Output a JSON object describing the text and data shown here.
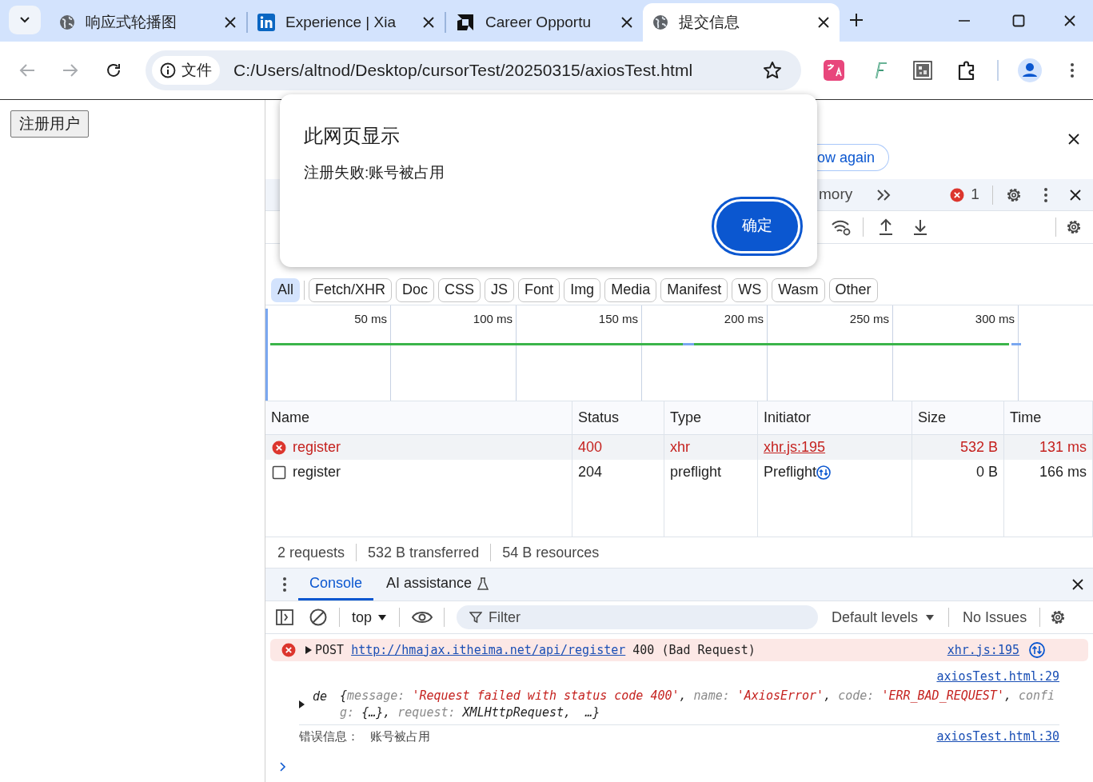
{
  "browser": {
    "tabs": [
      {
        "title": "响应式轮播图",
        "kind": "globe",
        "selected": false
      },
      {
        "title": "Experience | Xia",
        "kind": "linkedin",
        "selected": false
      },
      {
        "title": "Career Opportu",
        "kind": "amd",
        "selected": false
      },
      {
        "title": "提交信息",
        "kind": "globe",
        "selected": true
      }
    ],
    "address": {
      "security_label": "文件",
      "url": "C:/Users/altnod/Desktop/cursorTest/20250315/axiosTest.html"
    }
  },
  "page": {
    "button": "注册用户"
  },
  "dialog": {
    "title": "此网页显示",
    "message": "注册失败:账号被占用",
    "ok_button": "确定"
  },
  "devtools": {
    "notice_button": "ow again",
    "panel_tab": "mory",
    "error_count": "1",
    "filters": [
      {
        "label": "All",
        "selected": true
      },
      {
        "label": "Fetch/XHR",
        "selected": false
      },
      {
        "label": "Doc",
        "selected": false
      },
      {
        "label": "CSS",
        "selected": false
      },
      {
        "label": "JS",
        "selected": false
      },
      {
        "label": "Font",
        "selected": false
      },
      {
        "label": "Img",
        "selected": false
      },
      {
        "label": "Media",
        "selected": false
      },
      {
        "label": "Manifest",
        "selected": false
      },
      {
        "label": "WS",
        "selected": false
      },
      {
        "label": "Wasm",
        "selected": false
      },
      {
        "label": "Other",
        "selected": false
      }
    ],
    "timeline_labels": [
      "50 ms",
      "100 ms",
      "150 ms",
      "200 ms",
      "250 ms",
      "300 ms"
    ],
    "network": {
      "columns": [
        "Name",
        "Status",
        "Type",
        "Initiator",
        "Size",
        "Time"
      ],
      "rows": [
        {
          "kind": "error",
          "name": "register",
          "status": "400",
          "type": "xhr",
          "initiator": "xhr.js:195",
          "initiator_link": true,
          "size": "532 B",
          "time": "131 ms"
        },
        {
          "kind": "preflight",
          "name": "register",
          "status": "204",
          "type": "preflight",
          "initiator": "Preflight",
          "initiator_link": false,
          "size": "0 B",
          "time": "166 ms"
        }
      ]
    },
    "summary": [
      "2 requests",
      "532 B transferred",
      "54 B resources"
    ],
    "drawer_tabs": [
      {
        "label": "Console",
        "selected": true
      },
      {
        "label": "AI assistance",
        "selected": false
      }
    ],
    "console_toolbar": {
      "context": "top",
      "filter_placeholder": "Filter",
      "levels": "Default levels",
      "issues": "No Issues"
    },
    "messages": [
      {
        "kind": "error",
        "method": "POST",
        "url": "http://hmajax.itheima.net/api/register",
        "text": "400 (Bad Request)",
        "source": "xhr.js:195"
      },
      {
        "kind": "object",
        "source": "axiosTest.html:29",
        "label": "de",
        "parts": [
          {
            "kind": "plain",
            "text": "{"
          },
          {
            "kind": "key",
            "text": "message: "
          },
          {
            "kind": "string",
            "text": "'Request failed with status code 400'"
          },
          {
            "kind": "plain",
            "text": ", "
          },
          {
            "kind": "key",
            "text": "name: "
          },
          {
            "kind": "string",
            "text": "'AxiosError'"
          },
          {
            "kind": "plain",
            "text": ", "
          },
          {
            "kind": "key",
            "text": "code: "
          },
          {
            "kind": "string",
            "text": "'ERR_BAD_REQUEST'"
          },
          {
            "kind": "plain",
            "text": ", "
          },
          {
            "kind": "key",
            "text": "config: "
          },
          {
            "kind": "plain",
            "text": "{…}, "
          },
          {
            "kind": "key",
            "text": "request: "
          },
          {
            "kind": "plain",
            "text": "XMLHttpRequest,  …}"
          }
        ]
      },
      {
        "kind": "log",
        "label": "错误信息：",
        "text": "账号被占用",
        "source": "axiosTest.html:30"
      }
    ]
  }
}
